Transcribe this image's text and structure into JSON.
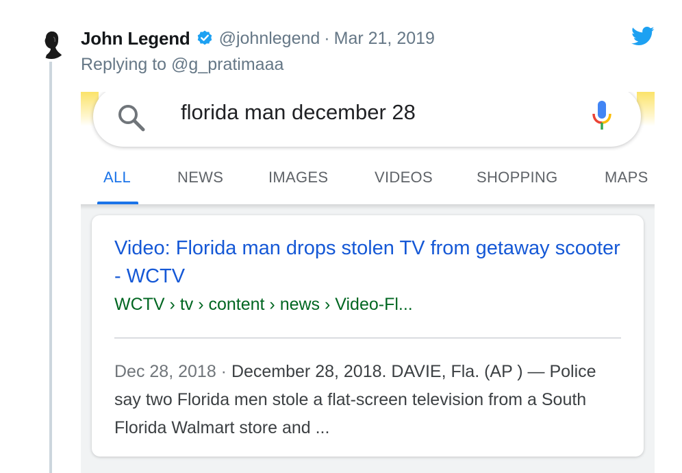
{
  "tweet": {
    "display_name": "John Legend",
    "handle": "@johnlegend",
    "separator": "·",
    "date": "Mar 21, 2019",
    "replying_prefix": "Replying to ",
    "replying_to": "@g_pratimaaa",
    "icons": {
      "avatar": "avatar",
      "verified": "verified-badge-icon",
      "twitter": "twitter-bird-icon"
    },
    "colors": {
      "name": "#14171a",
      "meta": "#657786",
      "verified": "#1da1f2",
      "bird": "#1da1f2"
    }
  },
  "google": {
    "query": "florida man december 28",
    "tabs": [
      {
        "label": "ALL",
        "active": true
      },
      {
        "label": "NEWS",
        "active": false
      },
      {
        "label": "IMAGES",
        "active": false
      },
      {
        "label": "VIDEOS",
        "active": false
      },
      {
        "label": "SHOPPING",
        "active": false
      },
      {
        "label": "MAPS",
        "active": false
      }
    ],
    "result": {
      "title": "Video: Florida man drops stolen TV from getaway scooter - WCTV",
      "breadcrumb": "WCTV › tv › content › news › Video-Fl...",
      "snippet_date": "Dec 28, 2018",
      "snippet_separator": " · ",
      "snippet_text": "December 28, 2018. DAVIE, Fla. (AP ) — Police say two Florida men stole a flat-screen television from a South Florida Walmart store and ..."
    },
    "icons": {
      "search": "search-icon",
      "mic": "mic-icon"
    },
    "colors": {
      "link": "#1558d6",
      "url": "#006621",
      "tab_active": "#1a73e8",
      "tab": "#5f6368",
      "snippet": "#3c4043"
    }
  }
}
